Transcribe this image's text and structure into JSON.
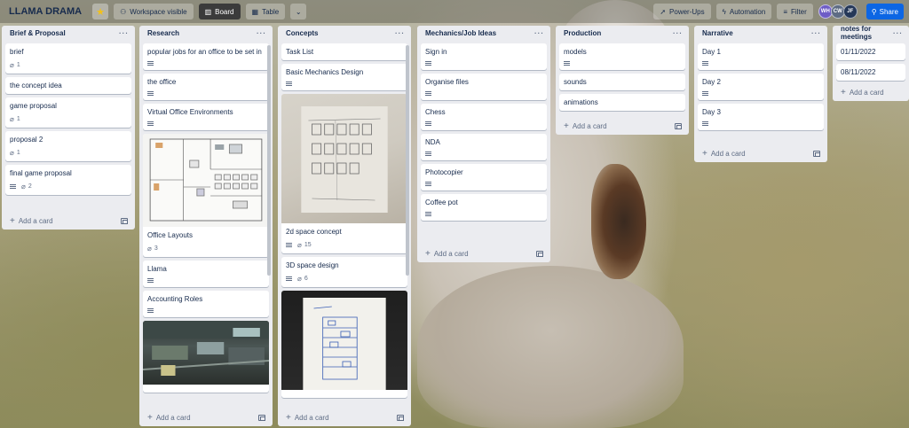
{
  "header": {
    "board_title": "LLAMA DRAMA",
    "visibility_label": "Workspace visible",
    "views": [
      "Board",
      "Table"
    ],
    "powerups_label": "Power-Ups",
    "automation_label": "Automation",
    "filter_label": "Filter",
    "members": [
      {
        "initials": "WH",
        "color": "#6e5dc6"
      },
      {
        "initials": "CW",
        "color": "#5e6c84"
      },
      {
        "initials": "JF",
        "color": "#253858"
      }
    ],
    "share_label": "Share"
  },
  "lists": [
    {
      "title": "Brief & Proposal",
      "cards": [
        {
          "title": "brief",
          "attachments": "1"
        },
        {
          "title": "the concept idea"
        },
        {
          "title": "game proposal",
          "attachments": "1"
        },
        {
          "title": "proposal 2",
          "attachments": "1"
        },
        {
          "title": "final game proposal",
          "description": true,
          "attachments": "2"
        }
      ],
      "add_label": "Add a card"
    },
    {
      "title": "Research",
      "cards": [
        {
          "title": "popular jobs for an office to be set in",
          "description": true
        },
        {
          "title": "the office",
          "description": true
        },
        {
          "title": "Virtual Office Environments",
          "description": true
        },
        {
          "title": "Office Layouts",
          "cover": "office-floorplan",
          "attachments": "3"
        },
        {
          "title": "Llama",
          "description": true
        },
        {
          "title": "Accounting Roles",
          "description": true
        },
        {
          "title": "",
          "cover": "office-photo"
        }
      ],
      "add_label": "Add a card"
    },
    {
      "title": "Concepts",
      "cards": [
        {
          "title": "Task List"
        },
        {
          "title": "Basic Mechanics Design",
          "description": true
        },
        {
          "title": "2d space concept",
          "cover": "sketch-2d",
          "description": true,
          "attachments": "15"
        },
        {
          "title": "3D space design",
          "description": true,
          "attachments": "6"
        },
        {
          "title": "",
          "cover": "sketch-3d"
        }
      ],
      "add_label": "Add a card"
    },
    {
      "title": "Mechanics/Job Ideas",
      "cards": [
        {
          "title": "Sign in",
          "description": true
        },
        {
          "title": "Organise files",
          "description": true
        },
        {
          "title": "Chess",
          "description": true
        },
        {
          "title": "NDA",
          "description": true
        },
        {
          "title": "Photocopier",
          "description": true
        },
        {
          "title": "Coffee pot",
          "description": true
        }
      ],
      "add_label": "Add a card"
    },
    {
      "title": "Production",
      "cards": [
        {
          "title": "models",
          "description": true
        },
        {
          "title": "sounds"
        },
        {
          "title": "animations"
        }
      ],
      "add_label": "Add a card"
    },
    {
      "title": "Narrative",
      "cards": [
        {
          "title": "Day 1",
          "description": true
        },
        {
          "title": "Day 2",
          "description": true
        },
        {
          "title": "Day 3",
          "description": true
        }
      ],
      "add_label": "Add a card"
    },
    {
      "title": "notes for meetings",
      "cards": [
        {
          "title": "01/11/2022"
        },
        {
          "title": "08/11/2022"
        }
      ],
      "add_label": "Add a card"
    }
  ]
}
